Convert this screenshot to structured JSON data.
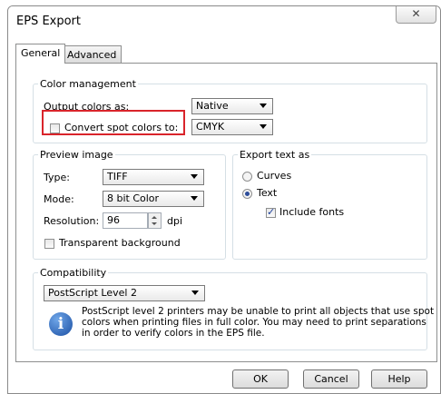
{
  "window": {
    "title": "EPS Export",
    "close_glyph": "✕"
  },
  "tabs": [
    {
      "label": "General"
    },
    {
      "label": "Advanced"
    }
  ],
  "color_management": {
    "legend": "Color management",
    "output_label": "Output colors as:",
    "output_value": "Native",
    "convert_label": "Convert spot colors to:",
    "convert_value": "CMYK"
  },
  "preview": {
    "legend": "Preview image",
    "type_label": "Type:",
    "type_value": "TIFF",
    "mode_label": "Mode:",
    "mode_value": "8 bit Color",
    "resolution_label": "Resolution:",
    "resolution_value": "96",
    "resolution_unit": "dpi",
    "transparent_label": "Transparent background"
  },
  "export_text": {
    "legend": "Export text as",
    "curves_label": "Curves",
    "text_label": "Text",
    "include_fonts_label": "Include fonts"
  },
  "compat": {
    "legend": "Compatibility",
    "value": "PostScript Level 2",
    "info": "PostScript level 2 printers may be unable to print all objects that use spot colors when printing files in full color. You may need to print separations in order to verify colors in the EPS file.",
    "info_lines": [
      "PostScript level 2 printers may be unable to print all objects that use spot",
      "colors when printing files in full color. You may need to print separations",
      "in order to verify colors in the EPS file."
    ]
  },
  "buttons": {
    "ok": "OK",
    "cancel": "Cancel",
    "help": "Help"
  },
  "colors": {
    "highlight": "#d9242b",
    "info_icon": "#1b4fa3"
  }
}
